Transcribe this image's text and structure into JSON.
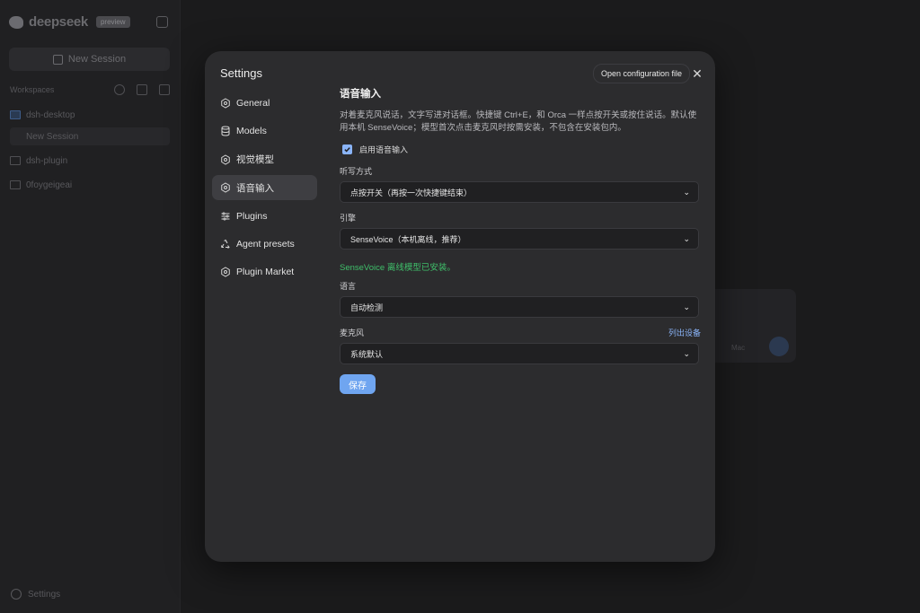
{
  "background": {
    "brand_name": "deepseek",
    "brand_badge": "preview",
    "new_session_label": "New Session",
    "workspaces_title": "Workspaces",
    "workspaces": [
      {
        "label": "dsh-desktop"
      },
      {
        "label": "New Session"
      },
      {
        "label": "dsh-plugin"
      },
      {
        "label": "0foygeigeai"
      }
    ],
    "settings_label": "Settings",
    "card_text": "Mac"
  },
  "modal": {
    "title": "Settings",
    "open_config_label": "Open configuration file",
    "close_glyph": "✕"
  },
  "nav": {
    "items": [
      {
        "label": "General",
        "icon": "gear-icon"
      },
      {
        "label": "Models",
        "icon": "database-icon"
      },
      {
        "label": "视觉模型",
        "icon": "gear-icon"
      },
      {
        "label": "语音输入",
        "icon": "gear-icon",
        "active": true
      },
      {
        "label": "Plugins",
        "icon": "sliders-icon"
      },
      {
        "label": "Agent presets",
        "icon": "recycle-icon"
      },
      {
        "label": "Plugin Market",
        "icon": "gear-icon"
      }
    ]
  },
  "voice": {
    "title": "语音输入",
    "description": "对着麦克风说话，文字写进对话框。快捷键 Ctrl+E，和 Orca 一样点按开关或按住说话。默认使用本机 SenseVoice；模型首次点击麦克风时按需安装，不包含在安装包内。",
    "enable_label": "启用语音输入",
    "enabled": true,
    "mode_label": "听写方式",
    "mode_value": "点按开关（再按一次快捷键结束）",
    "engine_label": "引擎",
    "engine_value": "SenseVoice（本机离线，推荐）",
    "engine_status": "SenseVoice 离线模型已安装。",
    "language_label": "语言",
    "language_value": "自动检测",
    "mic_label": "麦克风",
    "list_devices_label": "列出设备",
    "mic_value": "系统默认",
    "save_label": "保存",
    "chevron": "⌄"
  },
  "colors": {
    "accent": "#8ab4f8",
    "save_button": "#6fa5f0",
    "success": "#3fbf6a",
    "modal_bg": "#2c2c2e",
    "page_bg": "#1b1b1c"
  }
}
